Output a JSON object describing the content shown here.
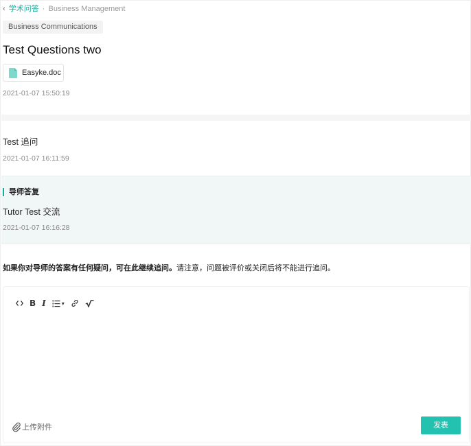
{
  "breadcrumb": {
    "back_glyph": "‹",
    "parent": "学术问答",
    "separator": "·",
    "current": "Business Management"
  },
  "question": {
    "tag": "Business Communications",
    "title": "Test Questions two",
    "attachment": {
      "icon": "file-doc-icon",
      "name": "Easyke.doc"
    },
    "time": "2021-01-07 15:50:19"
  },
  "followup": {
    "text": "Test 追问",
    "time": "2021-01-07 16:11:59"
  },
  "tutor_reply": {
    "label": "导师答复",
    "text": "Tutor Test 交流",
    "time": "2021-01-07 16:16:28"
  },
  "notice": {
    "bold": "如果你对导师的答案有任何疑问，可在此继续追问。",
    "normal": "请注意，问题被评价或关闭后将不能进行追问。"
  },
  "editor": {
    "toolbar": [
      {
        "name": "code-icon",
        "label": "<>"
      },
      {
        "name": "bold-icon",
        "label": "B"
      },
      {
        "name": "italic-icon",
        "label": "I"
      },
      {
        "name": "list-icon",
        "label": ""
      },
      {
        "name": "link-icon",
        "label": ""
      },
      {
        "name": "formula-icon",
        "label": ""
      }
    ],
    "value": "",
    "upload_label": "上传附件",
    "submit_label": "发表"
  },
  "colors": {
    "accent": "#1aa99a",
    "button": "#22c1b0",
    "tutor_bg": "#f0f7f6"
  }
}
